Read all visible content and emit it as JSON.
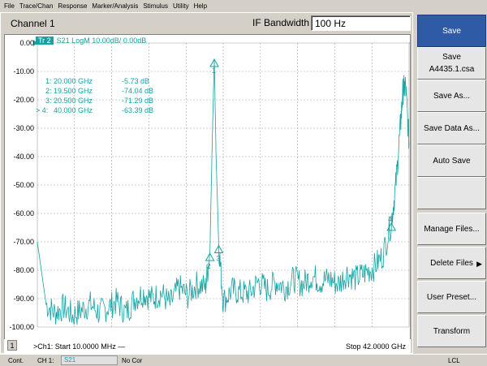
{
  "menu": [
    "File",
    "Trace/Chan",
    "Response",
    "Marker/Analysis",
    "Stimulus",
    "Utility",
    "Help"
  ],
  "channel": {
    "title": "Channel 1",
    "if_label": "IF Bandwidth",
    "if_value": "100 Hz"
  },
  "trace": {
    "tag": "Tr 2",
    "desc": "S21 LogM 10.00dB/  0.00dB"
  },
  "y_ticks": [
    "0.00",
    "-10.00",
    "-20.00",
    "-30.00",
    "-40.00",
    "-50.00",
    "-60.00",
    "-70.00",
    "-80.00",
    "-90.00",
    "-100.00"
  ],
  "markers": [
    {
      "label": "1:",
      "freq": "20.000 GHz",
      "val": "-5.73 dB"
    },
    {
      "label": "2:",
      "freq": "19.500 GHz",
      "val": "-74.04 dB"
    },
    {
      "label": "3:",
      "freq": "20.500 GHz",
      "val": "-71.29 dB"
    },
    {
      "label": "> 4:",
      "freq": "40.000 GHz",
      "val": "-63.39 dB"
    }
  ],
  "marker_tags": [
    "1",
    "2",
    "3",
    "4"
  ],
  "bottom": {
    "channel_num": "1",
    "start": ">Ch1: Start  10.0000 MHz —",
    "stop": "Stop  42.0000 GHz"
  },
  "softkeys": [
    {
      "l1": "Save",
      "l2": "",
      "active": true
    },
    {
      "l1": "Save",
      "l2": "A4435.1.csa",
      "active": false
    },
    {
      "l1": "Save As...",
      "l2": "",
      "active": false
    },
    {
      "l1": "Save Data As...",
      "l2": "",
      "active": false
    },
    {
      "l1": "Auto Save",
      "l2": "",
      "active": false
    },
    {
      "l1": "",
      "l2": "",
      "active": false
    },
    {
      "l1": "Manage Files...",
      "l2": "",
      "active": false
    },
    {
      "l1": "Delete Files",
      "l2": "",
      "active": false
    },
    {
      "l1": "User Preset...",
      "l2": "",
      "active": false
    },
    {
      "l1": "Transform",
      "l2": "",
      "active": false
    }
  ],
  "status": {
    "cont": "Cont.",
    "ch": "CH 1:",
    "param": "S21",
    "cor": "No Cor",
    "lcl": "LCL"
  },
  "colors": {
    "trace": "#16a2a2",
    "active_key": "#2f5ba6",
    "grid": "#a0a0a0"
  },
  "chart_data": {
    "type": "line",
    "title": "",
    "xlabel": "",
    "ylabel": "",
    "xlim": [
      0.01,
      42.0
    ],
    "ylim": [
      -103,
      2
    ],
    "series": [
      {
        "x": [
          0.01,
          1,
          2,
          3,
          4,
          5,
          6,
          7,
          8,
          9,
          10,
          11,
          12,
          13,
          14,
          15,
          16,
          17,
          18,
          19,
          19.5,
          19.8,
          20.0,
          20.2,
          20.5,
          21,
          22,
          23,
          24,
          25,
          26,
          27,
          28,
          29,
          30,
          31,
          32,
          33,
          34,
          35,
          36,
          37,
          38,
          39,
          40,
          40.5,
          41,
          41.3,
          41.6,
          42.0
        ],
        "y": [
          -70,
          -92,
          -95,
          -93,
          -96,
          -94,
          -92,
          -95,
          -93,
          -91,
          -95,
          -90,
          -88,
          -90,
          -88,
          -92,
          -86,
          -89,
          -85,
          -86,
          -74,
          -30,
          -5.7,
          -40,
          -71,
          -91,
          -87,
          -88,
          -88,
          -84,
          -87,
          -84,
          -86,
          -83,
          -85,
          -82,
          -84,
          -83,
          -85,
          -81,
          -83,
          -81,
          -79,
          -75,
          -63,
          -50,
          -30,
          -17,
          -15,
          -35
        ]
      }
    ]
  }
}
